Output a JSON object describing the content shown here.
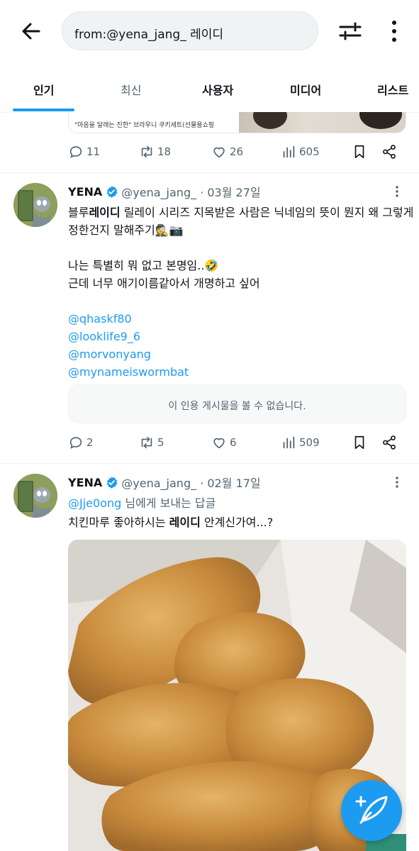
{
  "header": {
    "search_value": "from:@yena_jang_ 레이디",
    "back_icon": "arrow-left-icon",
    "filter_icon": "sliders-icon",
    "more_icon": "more-vertical-icon"
  },
  "tabs": [
    {
      "label": "인기",
      "active": true
    },
    {
      "label": "최신",
      "active": false
    },
    {
      "label": "사용자",
      "active": false
    },
    {
      "label": "미디어",
      "active": false
    },
    {
      "label": "리스트",
      "active": false
    }
  ],
  "partial_tweet": {
    "media_caption": "\"마음을 달래는 진한\" 브라우니 쿠키세트(선물용쇼핑",
    "replies": "11",
    "retweets": "18",
    "likes": "26",
    "views": "605"
  },
  "tweet1": {
    "name": "YENA",
    "handle": "@yena_jang_ · 03월 27일",
    "text_line1_pre": "블루",
    "text_line1_bold": "레이디",
    "text_line1_post": " 릴레이 시리즈 지목받은 사람은  닉네임의 뜻이 뭔지 왜 그렇게",
    "text_line2": "정한건지  말해주기🕵️📷",
    "text_line3": "나는 특별히 뭐 없고 본명임..🤣",
    "text_line4": "근데 너무 애기이름같아서 개명하고 싶어",
    "mentions": [
      "@qhaskf80",
      "@looklife9_6",
      "@morvonyang",
      "@mynameiswormbat"
    ],
    "quote_unavailable": "이 인용 게시물을 볼 수 없습니다.",
    "replies": "2",
    "retweets": "5",
    "likes": "6",
    "views": "509"
  },
  "tweet2": {
    "name": "YENA",
    "handle": "@yena_jang_ · 02월 17일",
    "reply_to_mention": "@Jje0ong",
    "reply_to_suffix": " 님에게 보내는 답글",
    "text_pre": "치킨마루 좋아하시는 ",
    "text_bold": "레이디",
    "text_post": " 안계신가여...?"
  },
  "colors": {
    "accent": "#1d9bf0",
    "secondary_text": "#536471"
  },
  "fab_icon": "compose-feather-plus-icon"
}
